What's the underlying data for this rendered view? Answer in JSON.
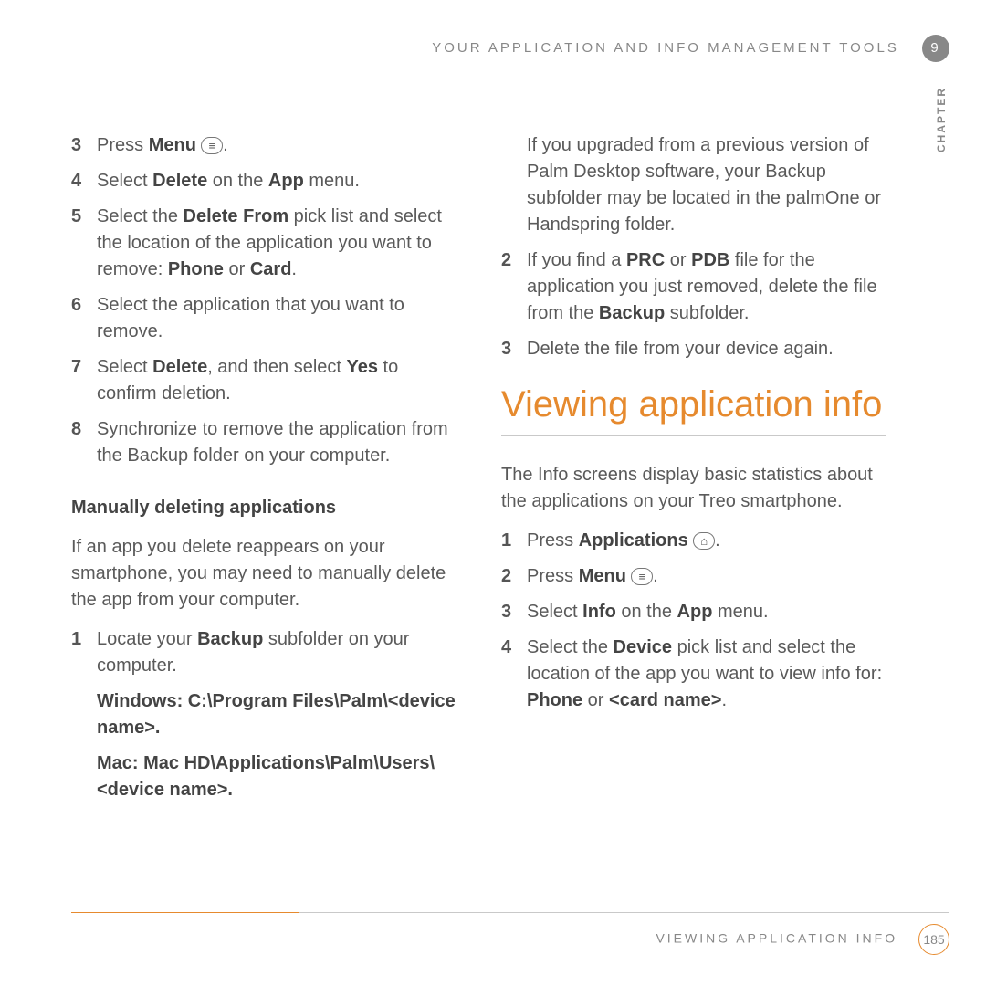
{
  "header": {
    "title": "YOUR APPLICATION AND INFO MANAGEMENT TOOLS",
    "chapter_number": "9",
    "chapter_label": "CHAPTER"
  },
  "left": {
    "steps_a": [
      {
        "n": "3",
        "pre": "Press ",
        "b": "Menu",
        "icon": "≡",
        "post": "."
      },
      {
        "n": "4",
        "pre": "Select ",
        "b": "Delete",
        "post": " on the ",
        "b2": "App",
        "post2": " menu."
      },
      {
        "n": "5",
        "pre": "Select the ",
        "b": "Delete From",
        "post": " pick list and select the location of the application you want to remove: ",
        "b2": "Phone",
        "post2": " or ",
        "b3": "Card",
        "post3": "."
      },
      {
        "n": "6",
        "text": "Select the application that you want to remove."
      },
      {
        "n": "7",
        "pre": "Select ",
        "b": "Delete",
        "post": ", and then select ",
        "b2": "Yes",
        "post2": " to confirm deletion."
      },
      {
        "n": "8",
        "text": "Synchronize to remove the application from the Backup folder on your computer."
      }
    ],
    "h3": "Manually deleting applications",
    "para": "If an app you delete reappears on your smartphone, you may need to manually delete the app from your computer.",
    "steps_b": [
      {
        "n": "1",
        "pre": "Locate your ",
        "b": "Backup",
        "post": " subfolder on your computer."
      }
    ],
    "win_label": "Windows: C:\\Program Files\\Palm\\<device name>.",
    "mac_label": "Mac: Mac HD\\Applications\\Palm\\Users\\<device name>."
  },
  "right": {
    "para1": "If you upgraded from a previous version of Palm Desktop software, your Backup subfolder may be located in the palmOne or Handspring folder.",
    "steps_a": [
      {
        "n": "2",
        "pre": "If you find a ",
        "b": "PRC",
        "post": " or ",
        "b2": "PDB",
        "post2": " file for the application you just removed, delete the file from the ",
        "b3": "Backup",
        "post3": " subfolder."
      },
      {
        "n": "3",
        "text": "Delete the file from your device again."
      }
    ],
    "section_title": "Viewing application info",
    "para2": "The Info screens display basic statistics about the applications on your Treo smartphone.",
    "steps_b": [
      {
        "n": "1",
        "pre": "Press ",
        "b": "Applications",
        "icon": "⌂",
        "post": "."
      },
      {
        "n": "2",
        "pre": "Press ",
        "b": "Menu",
        "icon": "≡",
        "post": "."
      },
      {
        "n": "3",
        "pre": "Select ",
        "b": "Info",
        "post": " on the ",
        "b2": "App",
        "post2": " menu."
      },
      {
        "n": "4",
        "pre": "Select the ",
        "b": "Device",
        "post": " pick list and select the location of the app you want to view info for: ",
        "b2": "Phone",
        "post2": " or ",
        "b3": "<card name>",
        "post3": "."
      }
    ]
  },
  "footer": {
    "text": "VIEWING APPLICATION INFO",
    "page": "185"
  }
}
